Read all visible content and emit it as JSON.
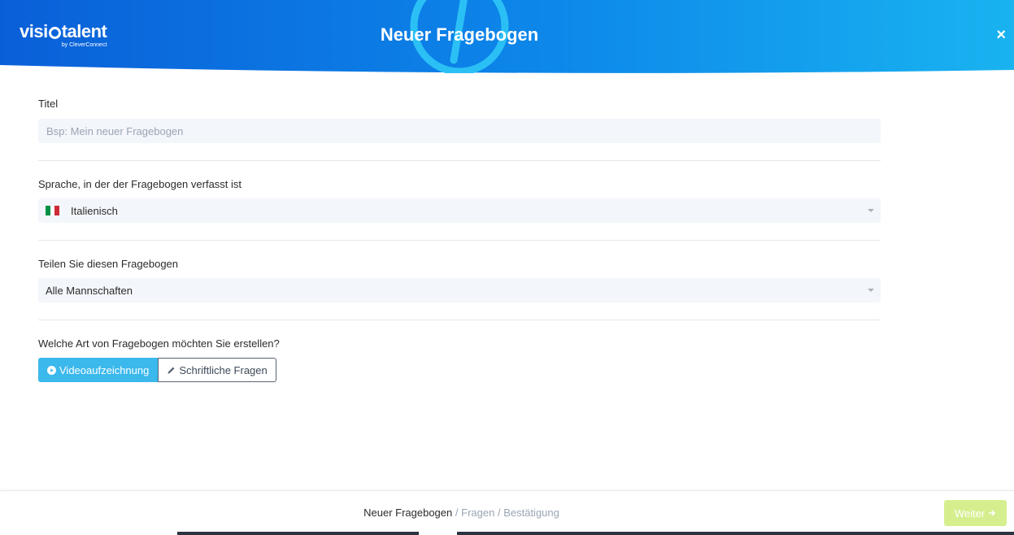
{
  "header": {
    "logo_main_a": "visi",
    "logo_main_b": "talent",
    "logo_sub": "by CleverConnect",
    "title": "Neuer Fragebogen",
    "close_label": "×",
    "colors": {
      "gradient_start": "#0a5fd8",
      "gradient_end": "#19b3f0",
      "accent_circle": "#2bc0f5"
    }
  },
  "form": {
    "title_field": {
      "label": "Titel",
      "value": "",
      "placeholder": "Bsp: Mein neuer Fragebogen"
    },
    "language_field": {
      "label": "Sprache, in der der Fragebogen verfasst ist",
      "value": "Italienisch",
      "flag_icon": "italy-flag-icon",
      "flag_colors": [
        "#009246",
        "#ffffff",
        "#ce2b37"
      ]
    },
    "share_field": {
      "label": "Teilen Sie diesen Fragebogen",
      "value": "Alle Mannschaften"
    },
    "type_field": {
      "label": "Welche Art von Fragebogen möchten Sie erstellen?",
      "options": [
        {
          "label": "Videoaufzeichnung",
          "icon": "play-circle-icon",
          "selected": true
        },
        {
          "label": "Schriftliche Fragen",
          "icon": "pencil-icon",
          "selected": false
        }
      ]
    }
  },
  "footer": {
    "breadcrumb": {
      "current": "Neuer Fragebogen",
      "step2": "Fragen",
      "step3": "Bestätigung",
      "separator": "/"
    },
    "next_label": "Weiter",
    "next_icon": "arrow-right-icon",
    "next_color": "#d5ef8f"
  }
}
